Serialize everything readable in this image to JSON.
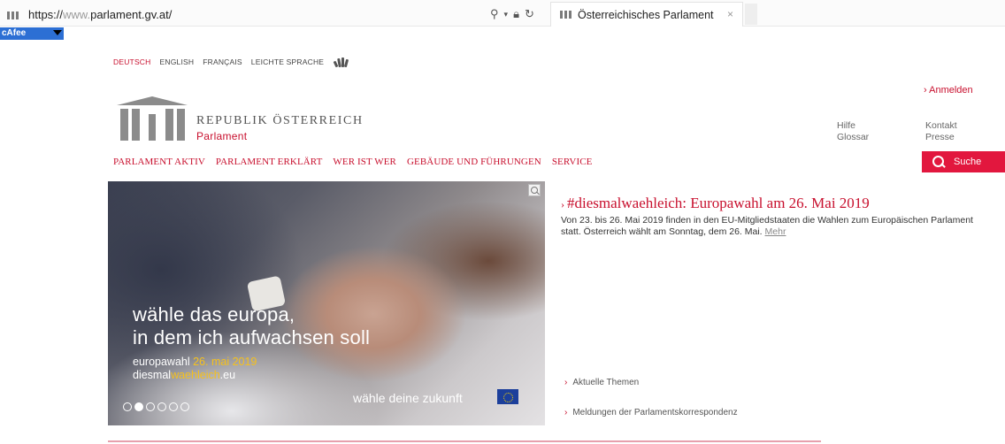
{
  "browser": {
    "url_proto": "https://",
    "url_www": "www.",
    "url_host": "parlament.gv.at/",
    "search_icon": "search-icon",
    "tab_title": "Österreichisches Parlament",
    "tab_close": "×"
  },
  "toolbar": {
    "mcafee_label": "cAfee"
  },
  "languages": {
    "items": [
      "DEUTSCH",
      "ENGLISH",
      "FRANÇAIS",
      "LEICHTE SPRACHE"
    ],
    "active_color": "#c8102e"
  },
  "header": {
    "login": "› Anmelden",
    "brand_title": "REPUBLIK ÖSTERREICH",
    "brand_sub": "Parlament",
    "help": "Hilfe",
    "glossary": "Glossar",
    "contact": "Kontakt",
    "press": "Presse"
  },
  "nav": {
    "items": [
      "PARLAMENT AKTIV",
      "PARLAMENT ERKLÄRT",
      "WER IST WER",
      "GEBÄUDE UND FÜHRUNGEN",
      "SERVICE"
    ],
    "search_label": "Suche",
    "accent": "#e2173e"
  },
  "hero": {
    "line1": "wähle das europa,",
    "line2": "in dem ich aufwachsen soll",
    "event_prefix": "europawahl ",
    "event_date": "26. mai 2019",
    "site_prefix": "diesmal",
    "site_highlight": "waehleich",
    "site_suffix": ".eu",
    "footer": "wähle deine zukunft",
    "slide_count": 6,
    "active_slide": 2
  },
  "news": {
    "title_prefix": "›",
    "title_hashtag": "#diesmalwaehleich: ",
    "title_main": "Europawahl am 26. Mai 2019",
    "body": "Von 23. bis 26. Mai 2019 finden in den EU-Mitgliedstaaten die Wahlen zum Europäischen Parlament statt. Österreich wählt am Sonntag, dem 26. Mai.",
    "more": "Mehr"
  },
  "quicklinks": [
    "Aktuelle Themen",
    "Meldungen der Parlamentskorrespondenz"
  ]
}
